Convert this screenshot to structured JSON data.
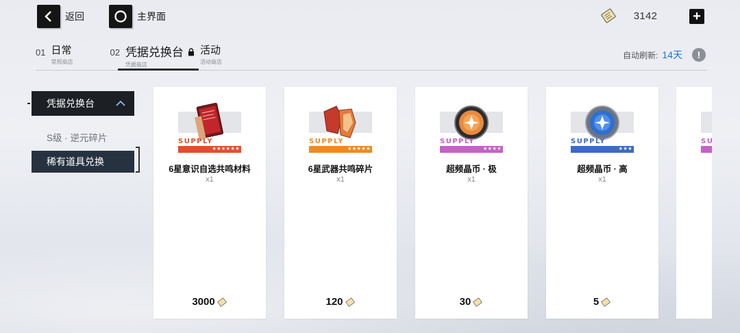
{
  "topbar": {
    "back_label": "返回",
    "home_label": "主界面",
    "currency_value": "3142"
  },
  "tabs": [
    {
      "num": "01",
      "label": "日常",
      "sub": "常规商店"
    },
    {
      "num": "02",
      "label": "凭据兑换台",
      "sub": "凭据商店"
    },
    {
      "num": "",
      "label": "活动",
      "sub": "活动商店"
    }
  ],
  "refresh": {
    "label": "自动刷新:",
    "value": "14天"
  },
  "sidebar": {
    "group_label": "凭据兑换台",
    "items": [
      {
        "label": "S级 · 逆元碎片"
      },
      {
        "label": "稀有道具兑换"
      }
    ]
  },
  "cards": [
    {
      "supply": "SUPPLY",
      "stars": "★★★★★★",
      "color": "#e0502a",
      "name": "6星意识自选共鸣材料",
      "qty": "x1",
      "price": "3000"
    },
    {
      "supply": "SUPPLY",
      "stars": "★★★★★",
      "color": "#f08a20",
      "name": "6星武器共鸣碎片",
      "qty": "x1",
      "price": "120"
    },
    {
      "supply": "SUPPLY",
      "stars": "★★★★",
      "color": "#c760c8",
      "name": "超频晶币 · 极",
      "qty": "x1",
      "price": "30"
    },
    {
      "supply": "SUPPLY",
      "stars": "★★★",
      "color": "#3a6bc6",
      "name": "超频晶币 · 高",
      "qty": "x1",
      "price": "5"
    }
  ],
  "partial_card": {
    "supply": "SUPP",
    "color": "#c760c8"
  },
  "colors": {
    "accent_blue": "#1f6fd6",
    "dark": "#1c1f24",
    "selected": "#263240"
  }
}
